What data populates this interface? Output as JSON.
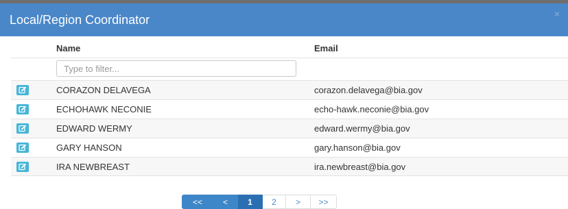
{
  "modal": {
    "title": "Local/Region Coordinator",
    "close_glyph": "×"
  },
  "table": {
    "headers": {
      "name": "Name",
      "email": "Email"
    },
    "filter": {
      "placeholder": "Type to filter...",
      "value": ""
    },
    "rows": [
      {
        "name": "CORAZON DELAVEGA",
        "email": "corazon.delavega@bia.gov"
      },
      {
        "name": "ECHOHAWK NECONIE",
        "email": "echo-hawk.neconie@bia.gov"
      },
      {
        "name": "EDWARD WERMY",
        "email": "edward.wermy@bia.gov"
      },
      {
        "name": "GARY HANSON",
        "email": "gary.hanson@bia.gov"
      },
      {
        "name": "IRA NEWBREAST",
        "email": "ira.newbreast@bia.gov"
      }
    ]
  },
  "pagination": {
    "first": "<<",
    "prev": "<",
    "pages": [
      "1",
      "2"
    ],
    "next": ">",
    "last": ">>",
    "current_page": "1"
  },
  "colors": {
    "header_bg": "#4a87c9",
    "edit_button": "#45b5d8",
    "pager_active": "#2b6fb3"
  }
}
